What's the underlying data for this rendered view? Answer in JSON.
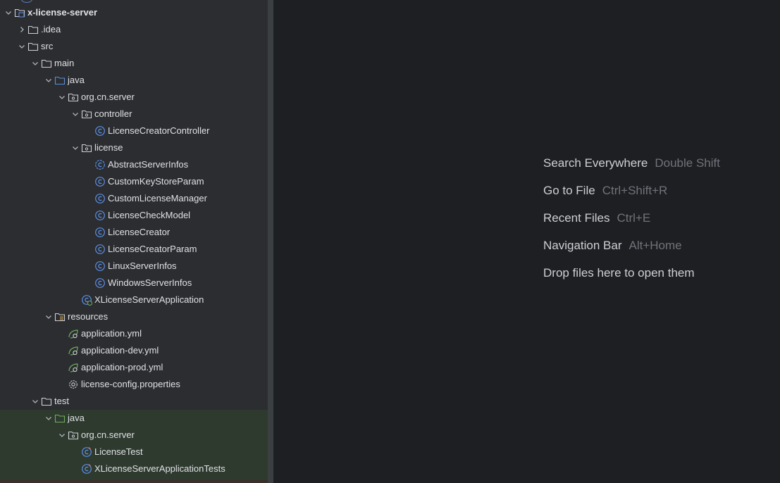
{
  "tree": [
    {
      "label": "x-license-server",
      "level": 0,
      "arrow": "down",
      "icon": "module-folder-icon",
      "bold": true
    },
    {
      "label": ".idea",
      "level": 1,
      "arrow": "right",
      "icon": "folder-icon"
    },
    {
      "label": "src",
      "level": 1,
      "arrow": "down",
      "icon": "folder-icon"
    },
    {
      "label": "main",
      "level": 2,
      "arrow": "down",
      "icon": "folder-icon"
    },
    {
      "label": "java",
      "level": 3,
      "arrow": "down",
      "icon": "source-folder-icon"
    },
    {
      "label": "org.cn.server",
      "level": 4,
      "arrow": "down",
      "icon": "package-icon"
    },
    {
      "label": "controller",
      "level": 5,
      "arrow": "down",
      "icon": "package-icon"
    },
    {
      "label": "LicenseCreatorController",
      "level": 6,
      "arrow": "none",
      "icon": "class-icon"
    },
    {
      "label": "license",
      "level": 5,
      "arrow": "down",
      "icon": "package-icon"
    },
    {
      "label": "AbstractServerInfos",
      "level": 6,
      "arrow": "none",
      "icon": "abstract-class-icon"
    },
    {
      "label": "CustomKeyStoreParam",
      "level": 6,
      "arrow": "none",
      "icon": "class-icon"
    },
    {
      "label": "CustomLicenseManager",
      "level": 6,
      "arrow": "none",
      "icon": "class-icon"
    },
    {
      "label": "LicenseCheckModel",
      "level": 6,
      "arrow": "none",
      "icon": "class-icon"
    },
    {
      "label": "LicenseCreator",
      "level": 6,
      "arrow": "none",
      "icon": "class-icon"
    },
    {
      "label": "LicenseCreatorParam",
      "level": 6,
      "arrow": "none",
      "icon": "class-icon"
    },
    {
      "label": "LinuxServerInfos",
      "level": 6,
      "arrow": "none",
      "icon": "class-icon"
    },
    {
      "label": "WindowsServerInfos",
      "level": 6,
      "arrow": "none",
      "icon": "class-icon"
    },
    {
      "label": "XLicenseServerApplication",
      "level": 5,
      "arrow": "none",
      "icon": "spring-boot-class-icon"
    },
    {
      "label": "resources",
      "level": 3,
      "arrow": "down",
      "icon": "resources-folder-icon"
    },
    {
      "label": "application.yml",
      "level": 4,
      "arrow": "none",
      "icon": "spring-config-icon"
    },
    {
      "label": "application-dev.yml",
      "level": 4,
      "arrow": "none",
      "icon": "spring-config-icon"
    },
    {
      "label": "application-prod.yml",
      "level": 4,
      "arrow": "none",
      "icon": "spring-config-icon"
    },
    {
      "label": "license-config.properties",
      "level": 4,
      "arrow": "none",
      "icon": "properties-gear-icon"
    },
    {
      "label": "test",
      "level": 2,
      "arrow": "down",
      "icon": "folder-icon"
    },
    {
      "label": "java",
      "level": 3,
      "arrow": "down",
      "icon": "test-source-folder-icon"
    },
    {
      "label": "org.cn.server",
      "level": 4,
      "arrow": "down",
      "icon": "package-icon"
    },
    {
      "label": "LicenseTest",
      "level": 5,
      "arrow": "none",
      "icon": "test-class-icon"
    },
    {
      "label": "XLicenseServerApplicationTests",
      "level": 5,
      "arrow": "none",
      "icon": "test-class-icon"
    }
  ],
  "hints": [
    {
      "action": "Search Everywhere",
      "shortcut": "Double Shift"
    },
    {
      "action": "Go to File",
      "shortcut": "Ctrl+Shift+R"
    },
    {
      "action": "Recent Files",
      "shortcut": "Ctrl+E"
    },
    {
      "action": "Navigation Bar",
      "shortcut": "Alt+Home"
    },
    {
      "action": "Drop files here to open them",
      "shortcut": ""
    }
  ],
  "colors": {
    "tree_text": "#dfe1e5",
    "folder": "#ced0d6",
    "source_folder": "#5a8fd8",
    "test_folder": "#6fae5e",
    "class_icon": "#5c8fe6",
    "spring": "#6fae5e",
    "hint_action": "#ced0d6",
    "hint_shortcut": "#6f737a"
  }
}
